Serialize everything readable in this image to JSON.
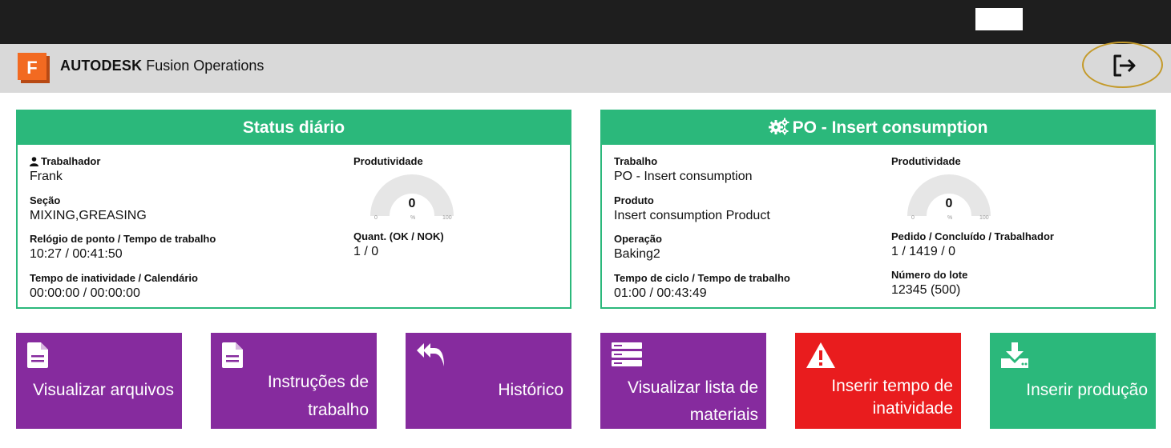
{
  "header": {
    "brand_bold": "AUTODESK",
    "brand_rest": " Fusion Operations",
    "logo_letter": "F"
  },
  "status_panel": {
    "title": "Status diário",
    "worker_label": "Trabalhador",
    "worker_value": "Frank",
    "section_label": "Seção",
    "section_value": "MIXING,GREASING",
    "clock_label": "Relógio de ponto / Tempo de trabalho",
    "clock_value": "10:27 / 00:41:50",
    "idle_label": "Tempo de inatividade / Calendário",
    "idle_value": "00:00:00 / 00:00:00",
    "productivity_label": "Produtividade",
    "gauge": {
      "value": "0",
      "min": "0",
      "max": "100",
      "unit": "%",
      "fraction": 0
    },
    "qty_label": "Quant. (OK / NOK)",
    "qty_value": "1 / 0"
  },
  "po_panel": {
    "title": "PO - Insert consumption",
    "job_label": "Trabalho",
    "job_value": "PO - Insert consumption",
    "product_label": "Produto",
    "product_value": "Insert consumption Product",
    "operation_label": "Operação",
    "operation_value": "Baking2",
    "cycle_label": "Tempo de ciclo / Tempo de trabalho",
    "cycle_value": "01:00 / 00:43:49",
    "productivity_label": "Produtividade",
    "gauge": {
      "value": "0",
      "min": "0",
      "max": "100",
      "unit": "%",
      "fraction": 0
    },
    "order_label": "Pedido / Concluído / Trabalhador",
    "order_value": "1 / 1419 / 0",
    "lot_label": "Número do lote",
    "lot_value": "12345 (500)"
  },
  "tiles": {
    "view_files": "Visualizar arquivos",
    "work_instructions_1": "Instruções de",
    "work_instructions_2": "trabalho",
    "history": "Histórico",
    "bom_1": "Visualizar lista de",
    "bom_2": "materiais",
    "downtime_1": "Inserir tempo de",
    "downtime_2": "inatividade",
    "production": "Inserir produção"
  },
  "colors": {
    "accent_green": "#2bb87b",
    "tile_purple": "#862b9e",
    "tile_red": "#e91c1e",
    "logo_orange": "#f26a21",
    "highlight_ring": "#c49a2a"
  }
}
